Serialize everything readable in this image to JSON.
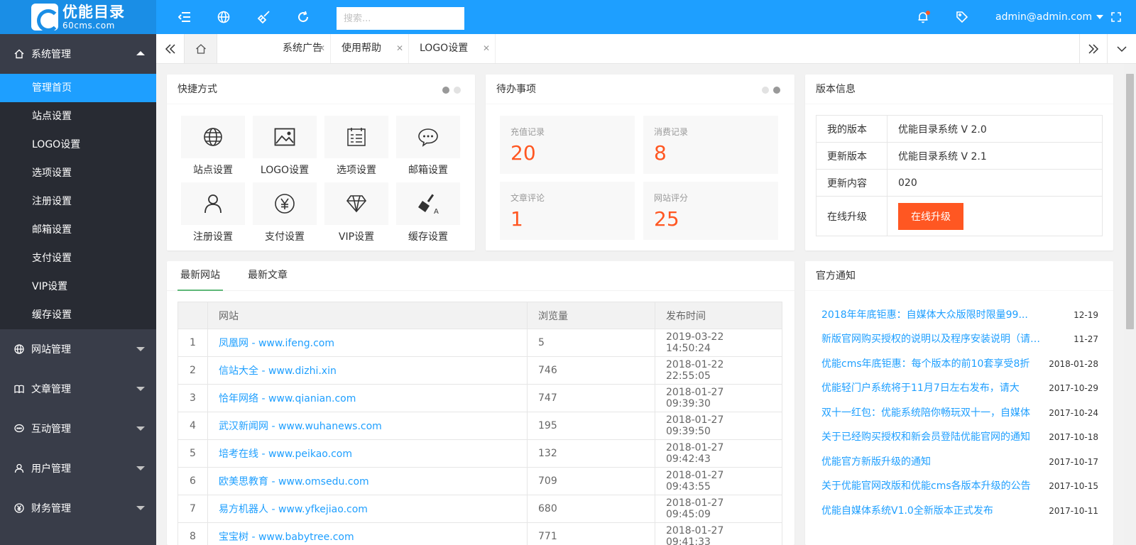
{
  "header": {
    "logo_name": "优能目录",
    "logo_sub": "60cms.com",
    "search_placeholder": "搜索...",
    "user": "admin@admin.com",
    "icons": [
      "menu-toggle-icon",
      "globe-icon",
      "broom-icon",
      "refresh-icon",
      "bell-icon",
      "tag-icon",
      "fullscreen-icon"
    ]
  },
  "sidebar": {
    "groups": [
      {
        "label": "系统管理",
        "icon": "home-icon",
        "expanded": true,
        "items": [
          "管理首页",
          "站点设置",
          "LOGO设置",
          "选项设置",
          "注册设置",
          "邮箱设置",
          "支付设置",
          "VIP设置",
          "缓存设置"
        ]
      },
      {
        "label": "网站管理",
        "icon": "globe-icon"
      },
      {
        "label": "文章管理",
        "icon": "book-icon"
      },
      {
        "label": "互动管理",
        "icon": "chat-icon"
      },
      {
        "label": "用户管理",
        "icon": "user-icon"
      },
      {
        "label": "财务管理",
        "icon": "yen-icon"
      }
    ],
    "active_item": "管理首页"
  },
  "tabs": [
    "系统广告",
    "使用帮助",
    "LOGO设置"
  ],
  "shortcuts": {
    "title": "快捷方式",
    "items": [
      {
        "label": "站点设置",
        "icon": "globe-icon"
      },
      {
        "label": "LOGO设置",
        "icon": "image-icon"
      },
      {
        "label": "选项设置",
        "icon": "form-icon"
      },
      {
        "label": "邮箱设置",
        "icon": "chat-icon"
      },
      {
        "label": "注册设置",
        "icon": "user-icon"
      },
      {
        "label": "支付设置",
        "icon": "yen-icon"
      },
      {
        "label": "VIP设置",
        "icon": "diamond-icon"
      },
      {
        "label": "缓存设置",
        "icon": "broom-icon"
      }
    ]
  },
  "todo": {
    "title": "待办事项",
    "items": [
      {
        "label": "充值记录",
        "value": "20"
      },
      {
        "label": "消费记录",
        "value": "8"
      },
      {
        "label": "文章评论",
        "value": "1"
      },
      {
        "label": "网站评分",
        "value": "25"
      }
    ]
  },
  "version": {
    "title": "版本信息",
    "rows": [
      {
        "k": "我的版本",
        "v": "优能目录系统 V 2.0"
      },
      {
        "k": "更新版本",
        "v": "优能目录系统 V 2.1"
      },
      {
        "k": "更新内容",
        "v": "020"
      }
    ],
    "upgrade_label": "在线升级",
    "upgrade_button": "在线升级"
  },
  "latest": {
    "tabs": [
      "最新网站",
      "最新文章"
    ],
    "columns": [
      "网站",
      "浏览量",
      "发布时间"
    ],
    "rows": [
      {
        "n": "1",
        "site": "凤凰网 - www.ifeng.com",
        "views": "5",
        "time": "2019-03-22 14:50:24"
      },
      {
        "n": "2",
        "site": "信站大全 - www.dizhi.xin",
        "views": "746",
        "time": "2018-01-22 22:55:05"
      },
      {
        "n": "3",
        "site": "恰年网络 - www.qianian.com",
        "views": "747",
        "time": "2018-01-27 09:39:30"
      },
      {
        "n": "4",
        "site": "武汉新闻网 - www.wuhanews.com",
        "views": "195",
        "time": "2018-01-27 09:39:50"
      },
      {
        "n": "5",
        "site": "培考在线 - www.peikao.com",
        "views": "132",
        "time": "2018-01-27 09:42:43"
      },
      {
        "n": "6",
        "site": "欧美思教育 - www.omsedu.com",
        "views": "709",
        "time": "2018-01-27 09:43:55"
      },
      {
        "n": "7",
        "site": "易方机器人 - www.yfkejiao.com",
        "views": "680",
        "time": "2018-01-27 09:45:09"
      },
      {
        "n": "8",
        "site": "宝宝树 - www.babytree.com",
        "views": "771",
        "time": "2018-01-27 09:41:33"
      }
    ]
  },
  "notices": {
    "title": "官方通知",
    "items": [
      {
        "text": "2018年年底钜惠：自媒体大众版限时限量99...",
        "date": "12-19"
      },
      {
        "text": "新版官网购买授权的说明以及程序安装说明（请详...",
        "date": "11-27"
      },
      {
        "text": "优能cms年底钜惠：每个版本的前10套享受8折",
        "date": "2018-01-28"
      },
      {
        "text": "优能轻门户系统将于11月7日左右发布，请大",
        "date": "2017-10-29"
      },
      {
        "text": "双十一红包：优能系统陪你畅玩双十一，自媒体",
        "date": "2017-10-24"
      },
      {
        "text": "关于已经购买授权和新会员登陆优能官网的通知",
        "date": "2017-10-18"
      },
      {
        "text": "优能官方新版升级的通知",
        "date": "2017-10-17"
      },
      {
        "text": "关于优能官网改版和优能cms各版本升级的公告",
        "date": "2017-10-15"
      },
      {
        "text": "优能自媒体系统V1.0全新版本正式发布",
        "date": "2017-10-11"
      }
    ]
  },
  "colors": {
    "primary": "#1e9fff",
    "sidebar": "#393d49",
    "accent": "#ff5722",
    "tab_underline": "#5fb878"
  }
}
